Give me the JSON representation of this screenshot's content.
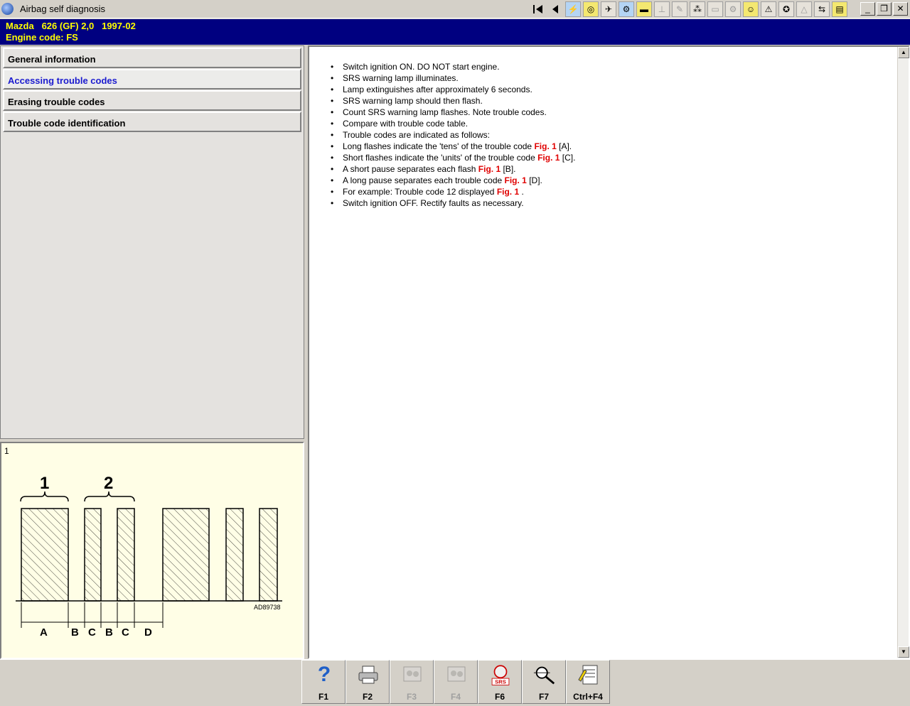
{
  "window": {
    "title": "Airbag self diagnosis",
    "controls": {
      "minimize": "_",
      "restore": "❐",
      "close": "✕"
    }
  },
  "toolbar_icons": [
    "diagram-icon",
    "component-icon",
    "tools-icon",
    "wiring-icon",
    "fuse-icon",
    "adjust-icon",
    "lubricant-icon",
    "timing-icon",
    "document-icon",
    "engine-icon",
    "service-icon",
    "warning-icon",
    "settings-icon",
    "caution-icon",
    "transfer-icon",
    "notes-icon"
  ],
  "vehicle": {
    "model_line": "Mazda   626 (GF) 2,0   1997-02",
    "engine_line": "Engine code: FS"
  },
  "menu": [
    {
      "label": "General information",
      "active": false
    },
    {
      "label": "Accessing trouble codes",
      "active": true
    },
    {
      "label": "Erasing trouble codes",
      "active": false
    },
    {
      "label": "Trouble code identification",
      "active": false
    }
  ],
  "figure": {
    "number": "1",
    "group_labels": [
      "1",
      "2"
    ],
    "interval_labels": [
      "A",
      "B",
      "C",
      "B",
      "C",
      "D"
    ],
    "reference": "AD89738"
  },
  "steps": [
    {
      "text": "Switch ignition ON. DO NOT start engine."
    },
    {
      "text": "SRS warning lamp illuminates."
    },
    {
      "text": "Lamp extinguishes after approximately 6 seconds."
    },
    {
      "text": "SRS warning lamp should then flash."
    },
    {
      "text": "Count SRS warning lamp flashes. Note trouble codes."
    },
    {
      "text": "Compare with trouble code table."
    },
    {
      "text": "Trouble codes are indicated as follows:"
    },
    {
      "text": "Long flashes indicate the 'tens' of the trouble code",
      "ref": "Fig. 1",
      "after": " [A]."
    },
    {
      "text": "Short flashes indicate the 'units' of the trouble code",
      "ref": "Fig. 1",
      "after": " [C]."
    },
    {
      "text": "A short pause separates each flash",
      "ref": "Fig. 1",
      "after": " [B]."
    },
    {
      "text": "A long pause separates each trouble code",
      "ref": "Fig. 1",
      "after": " [D]."
    },
    {
      "text": "For example: Trouble code 12 displayed",
      "ref": "Fig. 1",
      "after": " ."
    },
    {
      "text": "Switch ignition OFF. Rectify faults as necessary."
    }
  ],
  "fkeys": [
    {
      "label": "F1",
      "icon": "help-icon",
      "enabled": true
    },
    {
      "label": "F2",
      "icon": "print-icon",
      "enabled": true
    },
    {
      "label": "F3",
      "icon": "previous-figure-icon",
      "enabled": false
    },
    {
      "label": "F4",
      "icon": "next-figure-icon",
      "enabled": false
    },
    {
      "label": "F6",
      "icon": "srs-airbag-icon",
      "enabled": true,
      "badge": "SRS"
    },
    {
      "label": "F7",
      "icon": "magnifier-icon",
      "enabled": true
    },
    {
      "label": "Ctrl+F4",
      "icon": "notepad-icon",
      "enabled": true
    }
  ]
}
